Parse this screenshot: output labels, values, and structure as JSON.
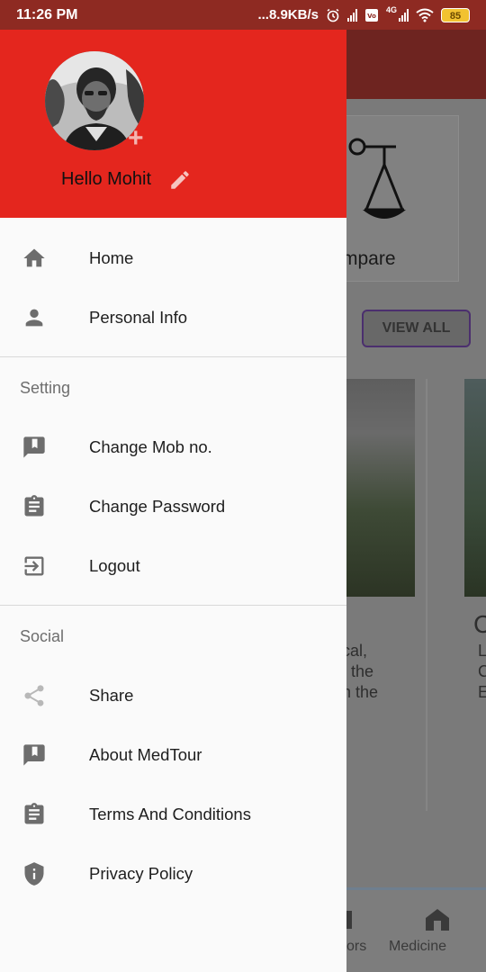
{
  "status_bar": {
    "time": "11:26 PM",
    "network_speed": "...8.9KB/s",
    "network_type": "4G",
    "battery": "85",
    "icons": [
      "alarm-icon",
      "signal-icon",
      "volte-icon",
      "wifi-icon",
      "battery-icon"
    ]
  },
  "drawer": {
    "header": {
      "greeting": "Hello Mohit",
      "add_photo_symbol": "+",
      "edit_icon": "pencil-icon"
    },
    "main_items": [
      {
        "label": "Home",
        "icon": "home-icon"
      },
      {
        "label": "Personal Info",
        "icon": "person-icon"
      }
    ],
    "setting_section": {
      "title": "Setting",
      "items": [
        {
          "label": "Change Mob no.",
          "icon": "feedback-icon"
        },
        {
          "label": "Change Password",
          "icon": "clipboard-icon"
        },
        {
          "label": "Logout",
          "icon": "logout-icon"
        }
      ]
    },
    "social_section": {
      "title": "Social",
      "items": [
        {
          "label": "Share",
          "icon": "share-icon"
        },
        {
          "label": "About MedTour",
          "icon": "feedback-icon"
        },
        {
          "label": "Terms And Conditions",
          "icon": "clipboard-icon"
        },
        {
          "label": "Privacy Policy",
          "icon": "shield-icon"
        }
      ]
    }
  },
  "background_app": {
    "compare_label": "mpare",
    "view_all_label": "VIEW ALL",
    "card_text_lines": [
      "cal,",
      "t the",
      "n the"
    ],
    "card2_text_lines": [
      "L",
      "C",
      "E"
    ],
    "card2_heading": "C",
    "bottom_nav": [
      {
        "label": "ors"
      },
      {
        "label": "Medicine"
      }
    ]
  },
  "colors": {
    "header_red": "#e4261e",
    "status_bar": "#8e2a22",
    "drawer_bg": "#fafafa",
    "icon_gray": "#6d6d6d"
  }
}
